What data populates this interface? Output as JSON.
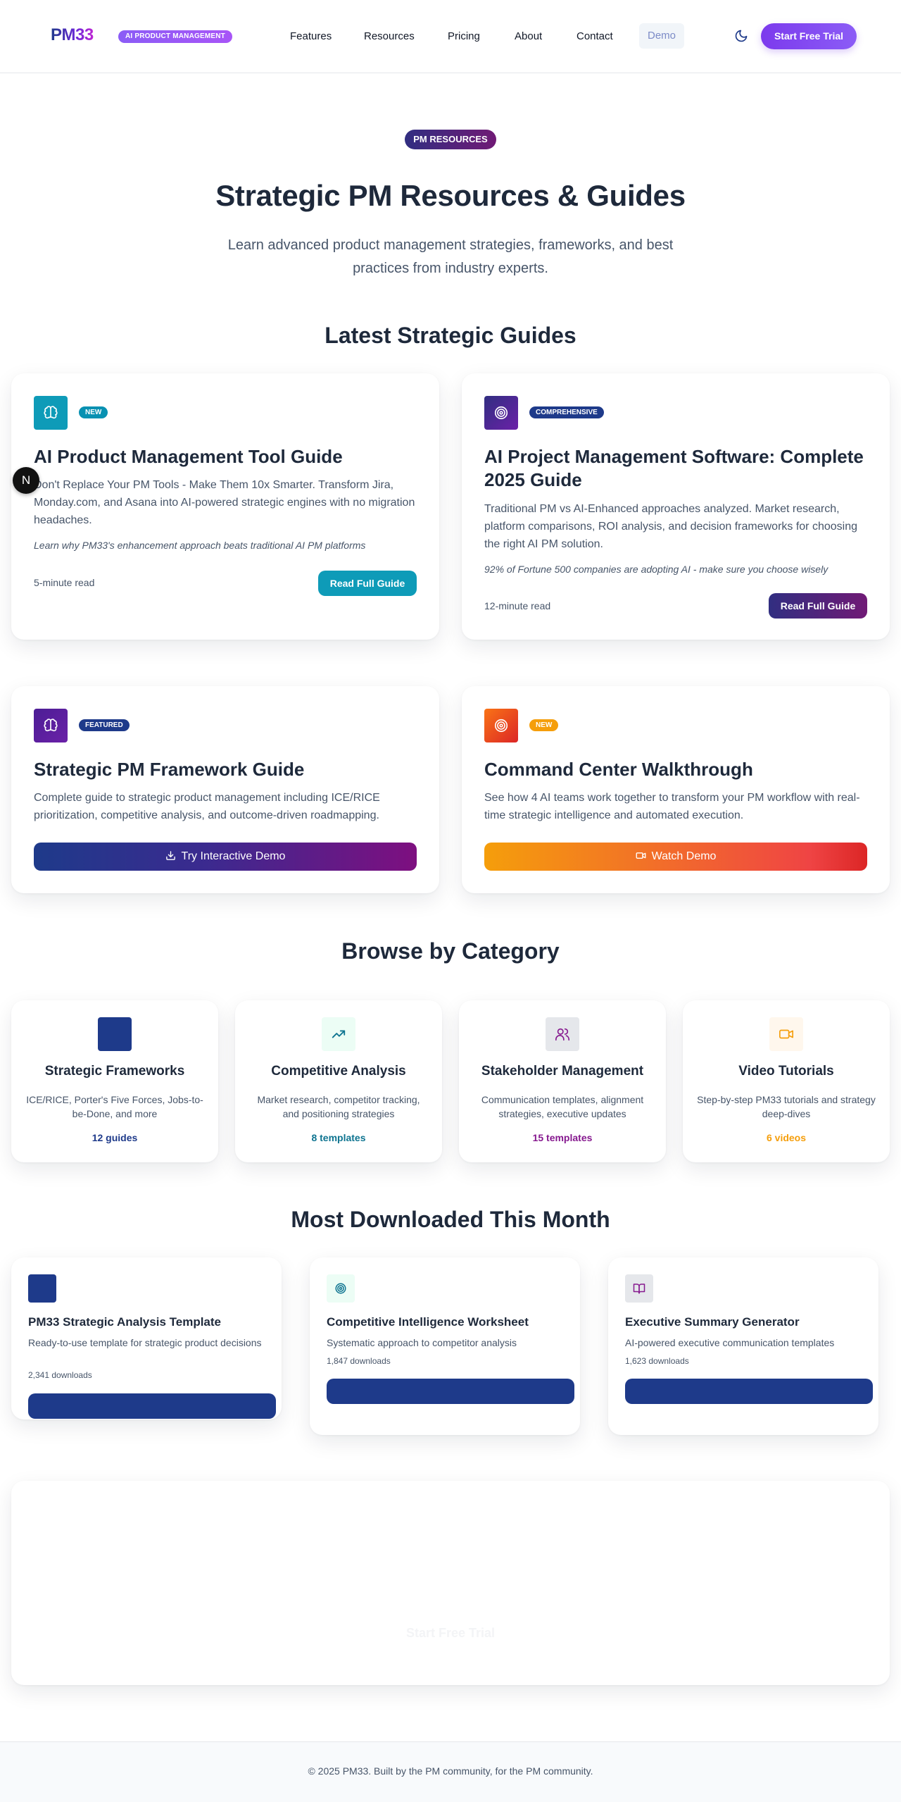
{
  "nav": {
    "logo": "PM33",
    "logo_badge": "AI PRODUCT MANAGEMENT",
    "links": [
      "Features",
      "Resources",
      "Pricing",
      "About",
      "Contact"
    ],
    "demo": "Demo",
    "theme_icon": "moon-icon",
    "trial": "Start Free Trial"
  },
  "hero": {
    "pill": "PM RESOURCES",
    "title": "Strategic PM Resources & Guides",
    "subtitle": "Learn advanced product management strategies, frameworks, and best practices from industry experts."
  },
  "guides": {
    "heading": "Latest Strategic Guides",
    "avatar": "N",
    "items": [
      {
        "icon": "brain-icon",
        "badge": "NEW",
        "title": "AI Product Management Tool Guide",
        "description": "Don't Replace Your PM Tools - Make Them 10x Smarter. Transform Jira, Monday.com, and Asana into AI-powered strategic engines with no migration headaches.",
        "note": "Learn why PM33's enhancement approach beats traditional AI PM platforms",
        "read_time": "5-minute read",
        "button": "Read Full Guide"
      },
      {
        "icon": "target-icon",
        "badge": "COMPREHENSIVE",
        "title": "AI Project Management Software: Complete 2025 Guide",
        "description": "Traditional PM vs AI-Enhanced approaches analyzed. Market research, platform comparisons, ROI analysis, and decision frameworks for choosing the right AI PM solution.",
        "note": "92% of Fortune 500 companies are adopting AI - make sure you choose wisely",
        "read_time": "12-minute read",
        "button": "Read Full Guide"
      },
      {
        "icon": "brain-icon",
        "badge": "FEATURED",
        "title": "Strategic PM Framework Guide",
        "description": "Complete guide to strategic product management including ICE/RICE prioritization, competitive analysis, and outcome-driven roadmapping.",
        "button": "Try Interactive Demo",
        "button_icon": "download-icon"
      },
      {
        "icon": "target-icon",
        "badge": "NEW",
        "title": "Command Center Walkthrough",
        "description": "See how 4 AI teams work together to transform your PM workflow with real-time strategic intelligence and automated execution.",
        "button": "Watch Demo",
        "button_icon": "video-icon"
      }
    ]
  },
  "categories": {
    "heading": "Browse by Category",
    "items": [
      {
        "icon": "frameworks-icon",
        "title": "Strategic Frameworks",
        "description": "ICE/RICE, Porter's Five Forces, Jobs-to-be-Done, and more",
        "count": "12 guides",
        "color": "#1e3a8a"
      },
      {
        "icon": "trending-up-icon",
        "title": "Competitive Analysis",
        "description": "Market research, competitor tracking, and positioning strategies",
        "count": "8 templates",
        "color": "#0e7490"
      },
      {
        "icon": "users-icon",
        "title": "Stakeholder Management",
        "description": "Communication templates, alignment strategies, executive updates",
        "count": "15 templates",
        "color": "#86198f"
      },
      {
        "icon": "video-icon",
        "title": "Video Tutorials",
        "description": "Step-by-step PM33 tutorials and strategy deep-dives",
        "count": "6 videos",
        "color": "#f59e0b"
      }
    ]
  },
  "downloads": {
    "heading": "Most Downloaded This Month",
    "items": [
      {
        "icon": "template-icon",
        "title": "PM33 Strategic Analysis Template",
        "description": "Ready-to-use template for strategic product decisions",
        "count": "2,341 downloads"
      },
      {
        "icon": "target-icon",
        "title": "Competitive Intelligence Worksheet",
        "description": "Systematic approach to competitor analysis",
        "count": "1,847 downloads"
      },
      {
        "icon": "book-icon",
        "title": "Executive Summary Generator",
        "description": "AI-powered executive communication templates",
        "count": "1,623 downloads"
      }
    ]
  },
  "cta": {
    "faded_text": "Start Free Trial"
  },
  "footer": {
    "text": "© 2025 PM33. Built by the PM community, for the PM community."
  }
}
